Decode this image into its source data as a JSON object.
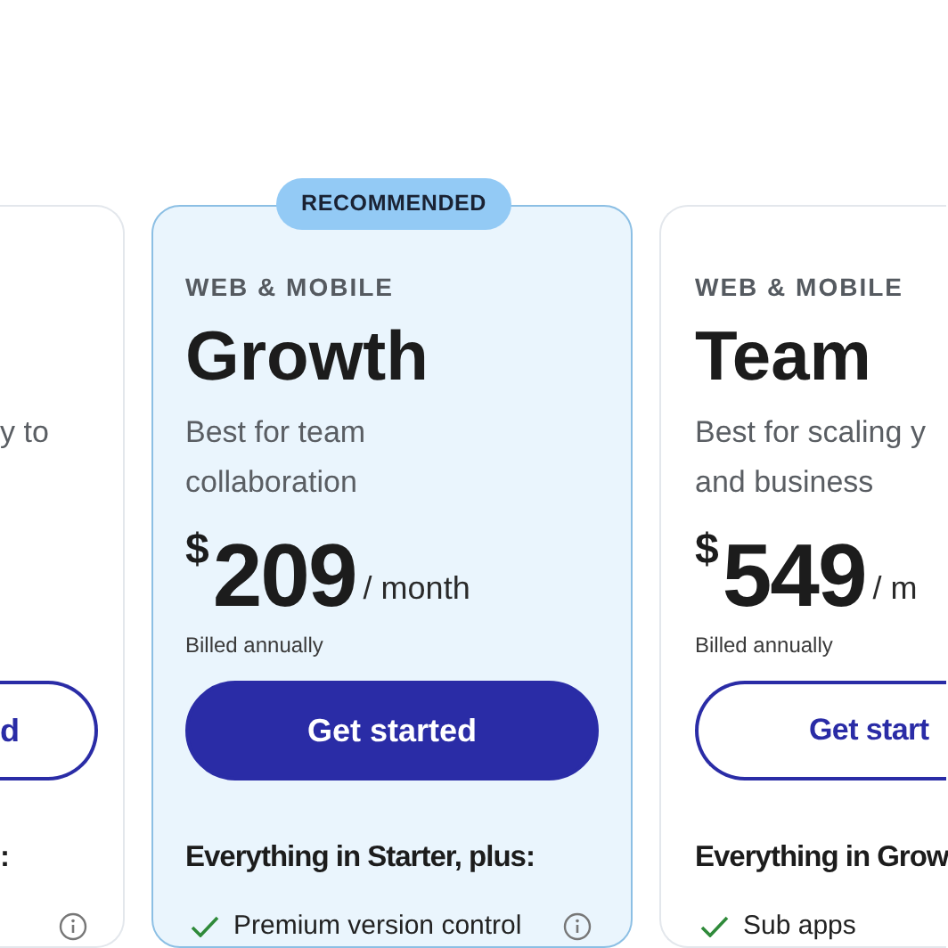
{
  "plans": [
    {
      "kind": "clipped_left",
      "recommended": false,
      "description": "y to",
      "cta": "d",
      "filled": false,
      "features_heading": ":",
      "features": [
        {
          "info": true
        }
      ]
    },
    {
      "kind": "full",
      "recommended": true,
      "badge": "RECOMMENDED",
      "category": "WEB & MOBILE",
      "name": "Growth",
      "description": "Best for team collaboration",
      "currency": "$",
      "price": "209",
      "period": "/ month",
      "billing": "Billed annually",
      "cta": "Get started",
      "filled": true,
      "features_heading": "Everything in Starter, plus:",
      "features": [
        {
          "text": "Premium version control",
          "info": true
        }
      ]
    },
    {
      "kind": "clipped_right",
      "recommended": false,
      "category": "WEB & MOBILE",
      "name": "Team",
      "description": "Best for scaling y and business",
      "currency": "$",
      "price": "549",
      "period": "/ m",
      "billing": "Billed annually",
      "cta": "Get start",
      "filled": false,
      "features_heading": "Everything in Grow",
      "features": [
        {
          "text": "Sub apps",
          "info": false
        }
      ]
    }
  ]
}
